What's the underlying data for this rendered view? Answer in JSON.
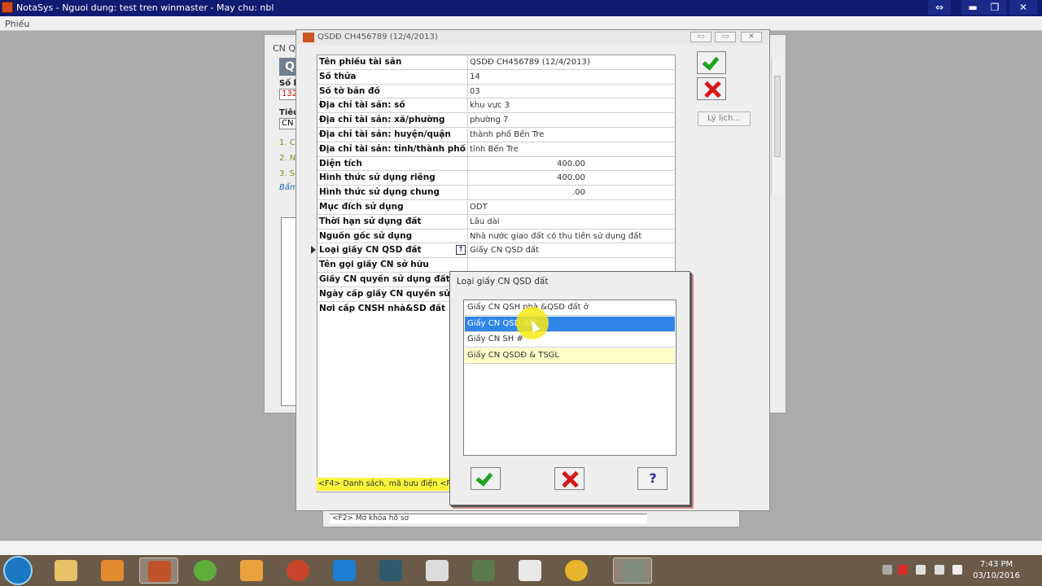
{
  "app": {
    "title": "NotaSys - Nguoi dung: test tren winmaster - May chu: nbl",
    "menu": "Phiếu",
    "controls": {
      "restore": "⇔",
      "minimize": "▬",
      "maximize": "❐",
      "close": "✕"
    }
  },
  "background_window": {
    "caption": "CN Q",
    "header": "Q",
    "label_so": "Số h",
    "field_so": "132",
    "label_tieu": "Tiêu",
    "field_tieu": "CN",
    "links": [
      "1. Ch",
      "2. Nh",
      "3. Sc",
      "Bấm"
    ]
  },
  "lower_window": {
    "hint": "<F2> Mở khóa hồ sơ"
  },
  "dialog": {
    "title": "QSDĐ CH456789 (12/4/2013)",
    "ctrl": {
      "min": "▭",
      "restore": "▭",
      "close": "✕"
    },
    "rows": [
      {
        "label": "Tên phiếu tài sản",
        "value": "QSDĐ CH456789 (12/4/2013)"
      },
      {
        "label": "Số thửa",
        "value": "14"
      },
      {
        "label": "Số tờ bản đồ",
        "value": "03"
      },
      {
        "label": "Địa chỉ tài sản: số",
        "value": "khu vực 3"
      },
      {
        "label": "Địa chỉ tài sản: xã/phường",
        "value": "phường 7"
      },
      {
        "label": "Địa chỉ tài sản: huyện/quận",
        "value": "thành phố Bến Tre"
      },
      {
        "label": "Địa chỉ tài sản: tỉnh/thành phố",
        "value": "tỉnh Bến Tre"
      },
      {
        "label": "Diện tích",
        "value": "400.00"
      },
      {
        "label": "Hình thức sử dụng riêng",
        "value": "400.00"
      },
      {
        "label": "Hình thức sử dụng chung",
        "value": ".00"
      },
      {
        "label": "Mục đích sử dụng",
        "value": "ODT"
      },
      {
        "label": "Thời hạn sử dụng đất",
        "value": "Lâu dài"
      },
      {
        "label": "Nguồn gốc sử dụng",
        "value": "Nhà nước giao đất có thu tiền sử dụng đất"
      },
      {
        "label": "Loại giấy CN QSD đất",
        "value": "Giấy CN QSD đất"
      },
      {
        "label": "Tên gọi giấy CN sở hữu",
        "value": ""
      },
      {
        "label": "Giấy CN quyền sử dụng đất số",
        "value": ""
      },
      {
        "label": "Ngày cấp giấy CN quyền sử dụng",
        "value": ""
      },
      {
        "label": "Nơi cấp CNSH nhà&SD đất",
        "value": ""
      }
    ],
    "hint": "<F4> Danh sách, mã bưu điện   <F5",
    "lylich": "Lý lịch...",
    "lookup_glyph": "↑"
  },
  "popup": {
    "title": "Loại giấy CN QSD đất",
    "items": [
      "Giấy CN QSH nhà &QSD đất ở",
      "Giấy CN QSD đất",
      "Giấy CN SH #",
      "Giấy CN QSDĐ & TSGL"
    ],
    "selected_index": 1,
    "help": "?"
  },
  "taskbar": {
    "time": "7:43 PM",
    "date": "03/10/2016"
  },
  "colors": {
    "titlebar": "#101b72",
    "selection": "#2f86e9",
    "hint": "#f7f53c",
    "ok": "#1fa31f",
    "cancel": "#d71818"
  }
}
